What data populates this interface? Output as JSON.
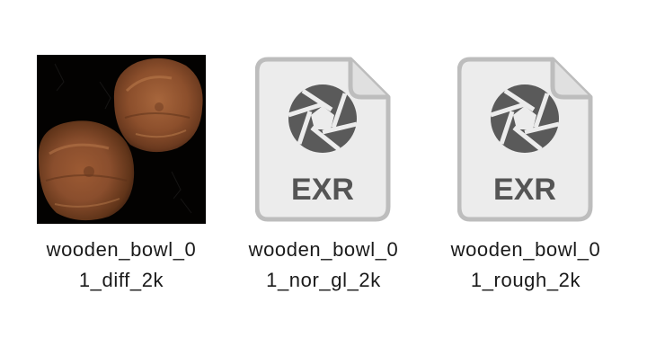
{
  "files": [
    {
      "name_line1": "wooden_bowl_0",
      "name_line2": "1_diff_2k",
      "icon": "texture-thumbnail-icon",
      "colors": {
        "background": "#030201",
        "wood": "#9a5a34"
      }
    },
    {
      "name_line1": "wooden_bowl_0",
      "name_line2": "1_nor_gl_2k",
      "icon": "exr-file-icon",
      "type_text": "EXR",
      "colors": {
        "fill": "#ececec",
        "outline": "#bdbdbd",
        "glyph": "#555555"
      }
    },
    {
      "name_line1": "wooden_bowl_0",
      "name_line2": "1_rough_2k",
      "icon": "exr-file-icon",
      "type_text": "EXR",
      "colors": {
        "fill": "#ececec",
        "outline": "#bdbdbd",
        "glyph": "#555555"
      }
    }
  ]
}
